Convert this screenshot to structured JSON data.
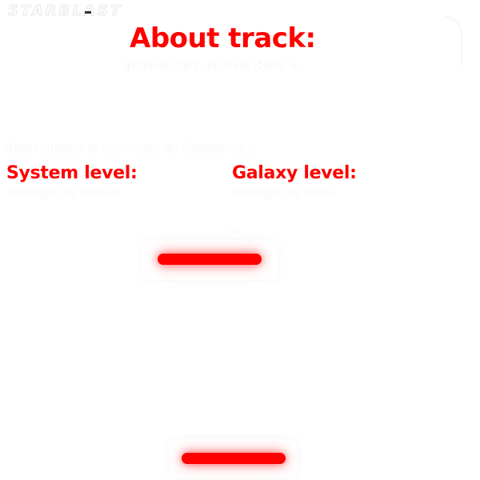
{
  "logo": {
    "text": "STARBLAST"
  },
  "about": {
    "title": "About track:",
    "subtitle": "prototype of the Red b",
    "description": "Best choice is b...          ...al, or Cancel to..."
  },
  "levels": {
    "system_label": "System level:",
    "galaxy_label": "Galaxy level:",
    "system_lap": "Average lap time:4",
    "galaxy_lap": "Average lap time:"
  },
  "misc": {
    "small_text": "M"
  },
  "buttons": {
    "top_button": "",
    "bottom_button": ""
  },
  "colors": {
    "accent": "#ff0000",
    "background": "#ffffff"
  }
}
